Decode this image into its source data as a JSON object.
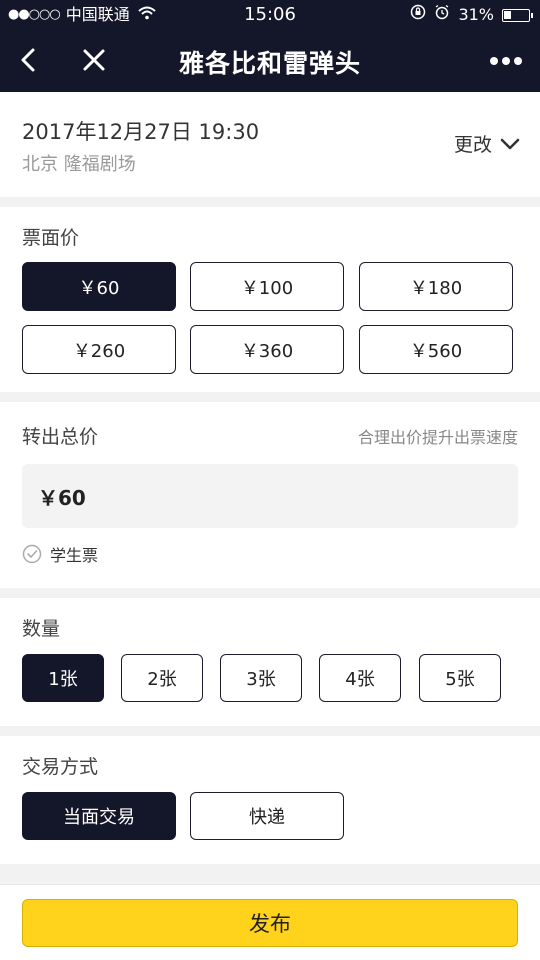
{
  "status_bar": {
    "signal": "●●○○○",
    "carrier": "中国联通",
    "time": "15:06",
    "battery_text": "31%",
    "battery_level": 0.31
  },
  "nav": {
    "title": "雅各比和雷弹头",
    "icons": [
      "chevron-left-icon",
      "close-icon",
      "more-icon"
    ]
  },
  "event": {
    "date": "2017年12月27日 19:30",
    "venue": "北京 隆福剧场",
    "change_label": "更改"
  },
  "ticket_price": {
    "title": "票面价",
    "options": [
      "￥60",
      "￥100",
      "￥180",
      "￥260",
      "￥360",
      "￥560"
    ],
    "selected_index": 0
  },
  "total_price": {
    "title": "转出总价",
    "hint": "合理出价提升出票速度",
    "value": "￥60",
    "student_label": "学生票"
  },
  "quantity": {
    "title": "数量",
    "options": [
      "1张",
      "2张",
      "3张",
      "4张",
      "5张"
    ],
    "selected_index": 0
  },
  "trade": {
    "title": "交易方式",
    "options": [
      "当面交易",
      "快递"
    ],
    "selected_index": 0
  },
  "publish_label": "发布",
  "colors": {
    "nav_bg": "#141629",
    "accent_yellow": "#ffd21c",
    "selected_bg": "#141629"
  }
}
